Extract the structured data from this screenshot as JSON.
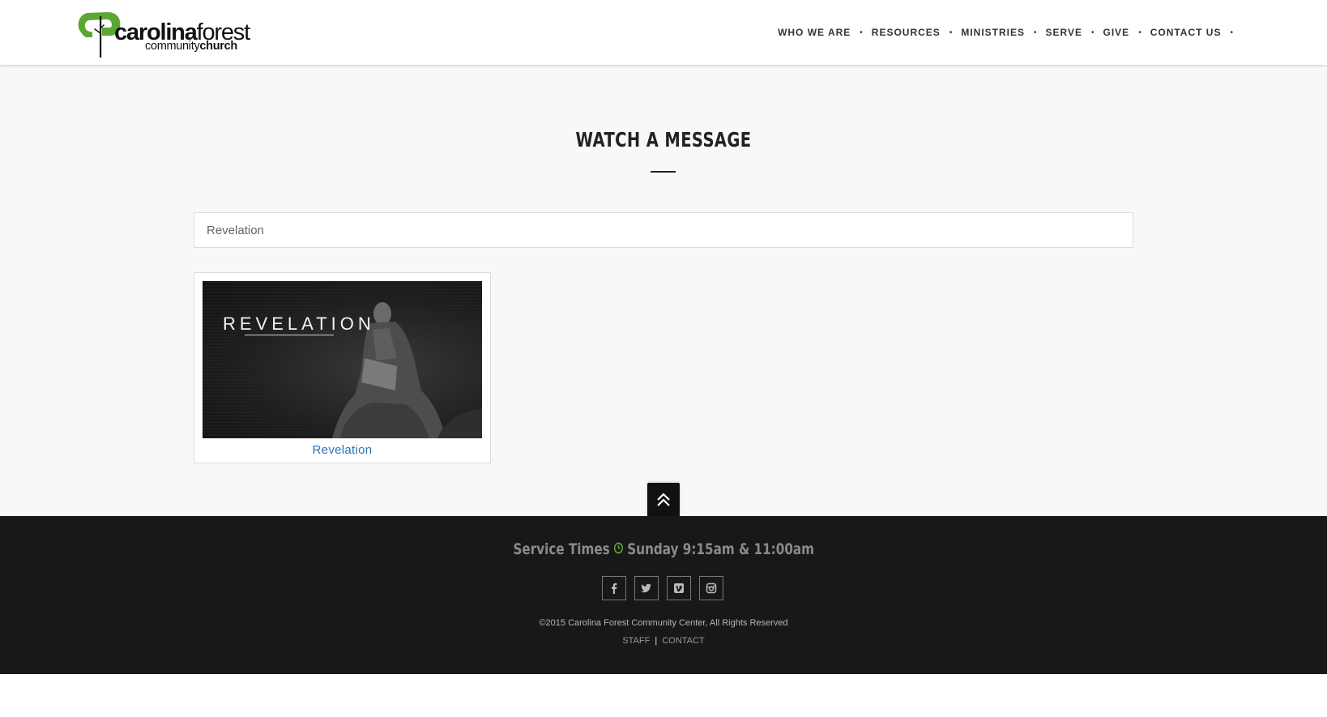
{
  "brand": {
    "name_bold": "carolina",
    "name_thin": "forest",
    "sub_thin": "community",
    "sub_bold": "church",
    "accent_color": "#5aa832"
  },
  "nav": {
    "items": [
      {
        "label": "WHO WE ARE"
      },
      {
        "label": "RESOURCES"
      },
      {
        "label": "MINISTRIES"
      },
      {
        "label": "SERVE"
      },
      {
        "label": "GIVE"
      },
      {
        "label": "CONTACT US"
      }
    ],
    "separator": "•"
  },
  "main": {
    "title": "WATCH A MESSAGE",
    "search": {
      "value": "Revelation"
    },
    "results": [
      {
        "thumbnail_text": "REVELATION",
        "link_label": "Revelation"
      }
    ],
    "link_color": "#2e6fb7"
  },
  "footer": {
    "service_label": "Service Times",
    "service_times": "Sunday 9:15am & 11:00am",
    "social_icons": [
      "facebook-icon",
      "twitter-icon",
      "vimeo-icon",
      "instagram-icon"
    ],
    "copyright": "©2015 Carolina Forest Community Center, All Rights Reserved",
    "links": [
      {
        "label": "STAFF"
      },
      {
        "label": "CONTACT"
      }
    ],
    "link_separator": "|"
  }
}
